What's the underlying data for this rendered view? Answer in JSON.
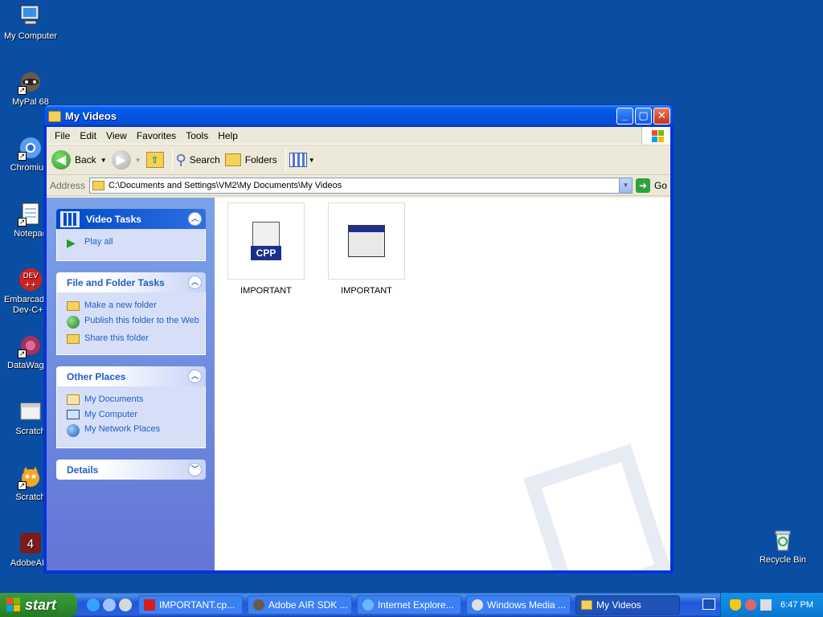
{
  "desktop": {
    "icons": [
      {
        "label": "My Computer"
      },
      {
        "label": "MyPal 68"
      },
      {
        "label": "Chromium"
      },
      {
        "label": "Notepad"
      },
      {
        "label": "Embarcadero Dev-C++"
      },
      {
        "label": "DataWagon"
      },
      {
        "label": "Scratch"
      },
      {
        "label": "Scratch"
      },
      {
        "label": "AdobeAIR"
      },
      {
        "label": "Recycle Bin"
      }
    ]
  },
  "window": {
    "title": "My Videos",
    "menu": [
      "File",
      "Edit",
      "View",
      "Favorites",
      "Tools",
      "Help"
    ],
    "toolbar": {
      "back": "Back",
      "search": "Search",
      "folders": "Folders"
    },
    "address": {
      "label": "Address",
      "value": "C:\\Documents and Settings\\VM2\\My Documents\\My Videos",
      "go": "Go"
    },
    "taskpane": {
      "video_tasks": {
        "title": "Video Tasks",
        "items": [
          "Play all"
        ]
      },
      "file_folder_tasks": {
        "title": "File and Folder Tasks",
        "items": [
          "Make a new folder",
          "Publish this folder to the Web",
          "Share this folder"
        ]
      },
      "other_places": {
        "title": "Other Places",
        "items": [
          "My Documents",
          "My Computer",
          "My Network Places"
        ]
      },
      "details": {
        "title": "Details"
      }
    },
    "files": [
      {
        "name": "IMPORTANT",
        "icon": "cpp-file-icon",
        "tag": "CPP"
      },
      {
        "name": "IMPORTANT",
        "icon": "application-window-icon"
      }
    ]
  },
  "taskbar": {
    "start": "start",
    "tasks": [
      {
        "label": "IMPORTANT.cp..."
      },
      {
        "label": "Adobe AIR SDK ..."
      },
      {
        "label": "Internet Explore..."
      },
      {
        "label": "Windows Media ..."
      },
      {
        "label": "My Videos",
        "active": true
      }
    ],
    "clock": "6:47 PM"
  },
  "colors": {
    "desktop": "#0a4ea3",
    "title_blue": "#0054e3",
    "task_link": "#215dc6"
  }
}
